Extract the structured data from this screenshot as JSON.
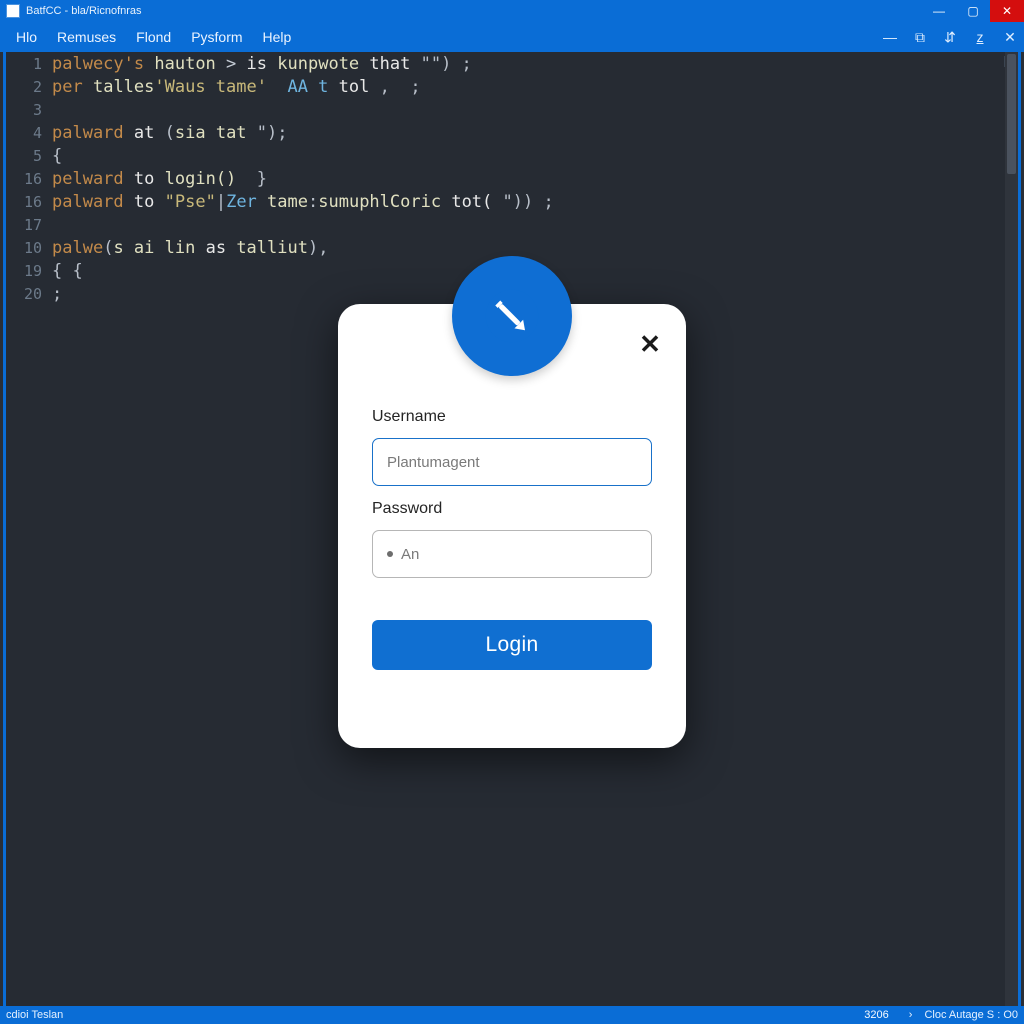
{
  "os_title": "BatfCC - bla/Ricnofnras",
  "menu": [
    "Hlo",
    "Remuses",
    "Flond",
    "Pysform",
    "Help"
  ],
  "code_lines": [
    {
      "n": "1",
      "html": "<span class='kw'>palwecy's</span> <span class='fn'>hauton</span> <span class='op'>&gt;</span> <span class='white'>is</span> <span class='fn'>kunpwote</span> <span class='white'>that</span><span class='punct'> \"\") ;</span>"
    },
    {
      "n": "2",
      "html": "<span class='kw'>per</span> <span class='fn'>talles</span><span class='str'>'Waus tame'</span>  <span class='type'>AA t</span> <span class='white'>tol</span> <span class='punct'>,  ;</span>"
    },
    {
      "n": "3",
      "html": ""
    },
    {
      "n": "4",
      "html": "<span class='kw'>palward</span> <span class='white'>at</span> <span class='punct'>(</span><span class='fn'>sia tat</span> <span class='punct'>\");</span>"
    },
    {
      "n": "5",
      "html": "<span class='punct'>{</span>"
    },
    {
      "n": "16",
      "html": "<span class='kw'>pelward</span> <span class='white'>to</span> <span class='fn'>login()</span>  <span class='punct'>}</span>"
    },
    {
      "n": "16",
      "html": "<span class='kw'>palward</span> <span class='white'>to</span> <span class='str'>\"Pse\"</span><span class='punct'>|</span><span class='type'>Zer</span> <span class='fn'>tame</span><span class='punct'>:</span><span class='fn'>sumuphlCoric</span> <span class='white'>tot(</span> <span class='punct'>\")) ;</span>"
    },
    {
      "n": "17",
      "html": ""
    },
    {
      "n": "10",
      "html": "<span class='kw'>palwe</span><span class='punct'>(</span><span class='fn'>s ai lin</span> <span class='white'>as</span> <span class='fn'>talliut</span><span class='punct'>),</span>"
    },
    {
      "n": "19",
      "html": "<span class='punct'>{ {</span>"
    },
    {
      "n": "20",
      "html": "<span class='punct'>;</span>"
    }
  ],
  "modal": {
    "username_label": "Username",
    "username_placeholder": "Plantumagent",
    "password_label": "Password",
    "password_display": "An",
    "login_button": "Login"
  },
  "status": {
    "left": "cdioi Teslan",
    "num": "3206",
    "right": "Cloc  Autage  S :  O0"
  }
}
